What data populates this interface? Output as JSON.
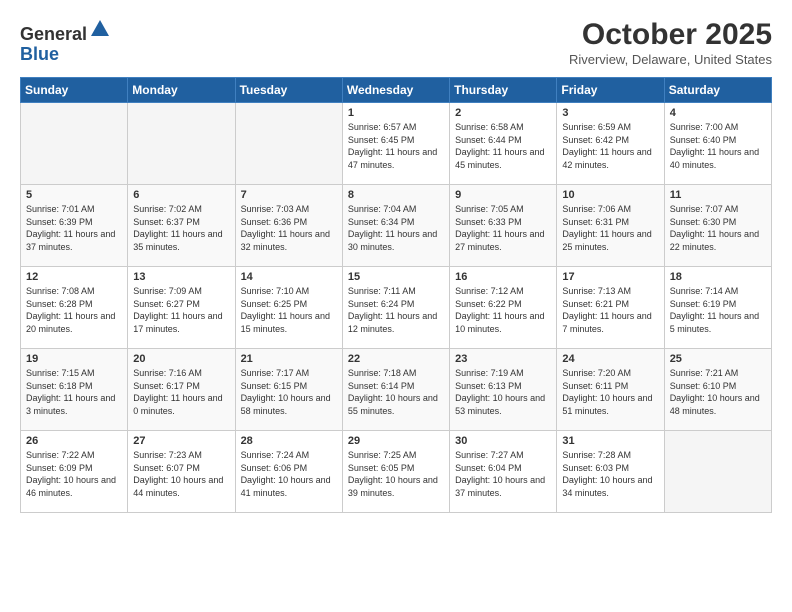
{
  "logo": {
    "general": "General",
    "blue": "Blue"
  },
  "header": {
    "month": "October 2025",
    "location": "Riverview, Delaware, United States"
  },
  "weekdays": [
    "Sunday",
    "Monday",
    "Tuesday",
    "Wednesday",
    "Thursday",
    "Friday",
    "Saturday"
  ],
  "weeks": [
    [
      {
        "day": "",
        "info": ""
      },
      {
        "day": "",
        "info": ""
      },
      {
        "day": "",
        "info": ""
      },
      {
        "day": "1",
        "info": "Sunrise: 6:57 AM\nSunset: 6:45 PM\nDaylight: 11 hours\nand 47 minutes."
      },
      {
        "day": "2",
        "info": "Sunrise: 6:58 AM\nSunset: 6:44 PM\nDaylight: 11 hours\nand 45 minutes."
      },
      {
        "day": "3",
        "info": "Sunrise: 6:59 AM\nSunset: 6:42 PM\nDaylight: 11 hours\nand 42 minutes."
      },
      {
        "day": "4",
        "info": "Sunrise: 7:00 AM\nSunset: 6:40 PM\nDaylight: 11 hours\nand 40 minutes."
      }
    ],
    [
      {
        "day": "5",
        "info": "Sunrise: 7:01 AM\nSunset: 6:39 PM\nDaylight: 11 hours\nand 37 minutes."
      },
      {
        "day": "6",
        "info": "Sunrise: 7:02 AM\nSunset: 6:37 PM\nDaylight: 11 hours\nand 35 minutes."
      },
      {
        "day": "7",
        "info": "Sunrise: 7:03 AM\nSunset: 6:36 PM\nDaylight: 11 hours\nand 32 minutes."
      },
      {
        "day": "8",
        "info": "Sunrise: 7:04 AM\nSunset: 6:34 PM\nDaylight: 11 hours\nand 30 minutes."
      },
      {
        "day": "9",
        "info": "Sunrise: 7:05 AM\nSunset: 6:33 PM\nDaylight: 11 hours\nand 27 minutes."
      },
      {
        "day": "10",
        "info": "Sunrise: 7:06 AM\nSunset: 6:31 PM\nDaylight: 11 hours\nand 25 minutes."
      },
      {
        "day": "11",
        "info": "Sunrise: 7:07 AM\nSunset: 6:30 PM\nDaylight: 11 hours\nand 22 minutes."
      }
    ],
    [
      {
        "day": "12",
        "info": "Sunrise: 7:08 AM\nSunset: 6:28 PM\nDaylight: 11 hours\nand 20 minutes."
      },
      {
        "day": "13",
        "info": "Sunrise: 7:09 AM\nSunset: 6:27 PM\nDaylight: 11 hours\nand 17 minutes."
      },
      {
        "day": "14",
        "info": "Sunrise: 7:10 AM\nSunset: 6:25 PM\nDaylight: 11 hours\nand 15 minutes."
      },
      {
        "day": "15",
        "info": "Sunrise: 7:11 AM\nSunset: 6:24 PM\nDaylight: 11 hours\nand 12 minutes."
      },
      {
        "day": "16",
        "info": "Sunrise: 7:12 AM\nSunset: 6:22 PM\nDaylight: 11 hours\nand 10 minutes."
      },
      {
        "day": "17",
        "info": "Sunrise: 7:13 AM\nSunset: 6:21 PM\nDaylight: 11 hours\nand 7 minutes."
      },
      {
        "day": "18",
        "info": "Sunrise: 7:14 AM\nSunset: 6:19 PM\nDaylight: 11 hours\nand 5 minutes."
      }
    ],
    [
      {
        "day": "19",
        "info": "Sunrise: 7:15 AM\nSunset: 6:18 PM\nDaylight: 11 hours\nand 3 minutes."
      },
      {
        "day": "20",
        "info": "Sunrise: 7:16 AM\nSunset: 6:17 PM\nDaylight: 11 hours\nand 0 minutes."
      },
      {
        "day": "21",
        "info": "Sunrise: 7:17 AM\nSunset: 6:15 PM\nDaylight: 10 hours\nand 58 minutes."
      },
      {
        "day": "22",
        "info": "Sunrise: 7:18 AM\nSunset: 6:14 PM\nDaylight: 10 hours\nand 55 minutes."
      },
      {
        "day": "23",
        "info": "Sunrise: 7:19 AM\nSunset: 6:13 PM\nDaylight: 10 hours\nand 53 minutes."
      },
      {
        "day": "24",
        "info": "Sunrise: 7:20 AM\nSunset: 6:11 PM\nDaylight: 10 hours\nand 51 minutes."
      },
      {
        "day": "25",
        "info": "Sunrise: 7:21 AM\nSunset: 6:10 PM\nDaylight: 10 hours\nand 48 minutes."
      }
    ],
    [
      {
        "day": "26",
        "info": "Sunrise: 7:22 AM\nSunset: 6:09 PM\nDaylight: 10 hours\nand 46 minutes."
      },
      {
        "day": "27",
        "info": "Sunrise: 7:23 AM\nSunset: 6:07 PM\nDaylight: 10 hours\nand 44 minutes."
      },
      {
        "day": "28",
        "info": "Sunrise: 7:24 AM\nSunset: 6:06 PM\nDaylight: 10 hours\nand 41 minutes."
      },
      {
        "day": "29",
        "info": "Sunrise: 7:25 AM\nSunset: 6:05 PM\nDaylight: 10 hours\nand 39 minutes."
      },
      {
        "day": "30",
        "info": "Sunrise: 7:27 AM\nSunset: 6:04 PM\nDaylight: 10 hours\nand 37 minutes."
      },
      {
        "day": "31",
        "info": "Sunrise: 7:28 AM\nSunset: 6:03 PM\nDaylight: 10 hours\nand 34 minutes."
      },
      {
        "day": "",
        "info": ""
      }
    ]
  ]
}
